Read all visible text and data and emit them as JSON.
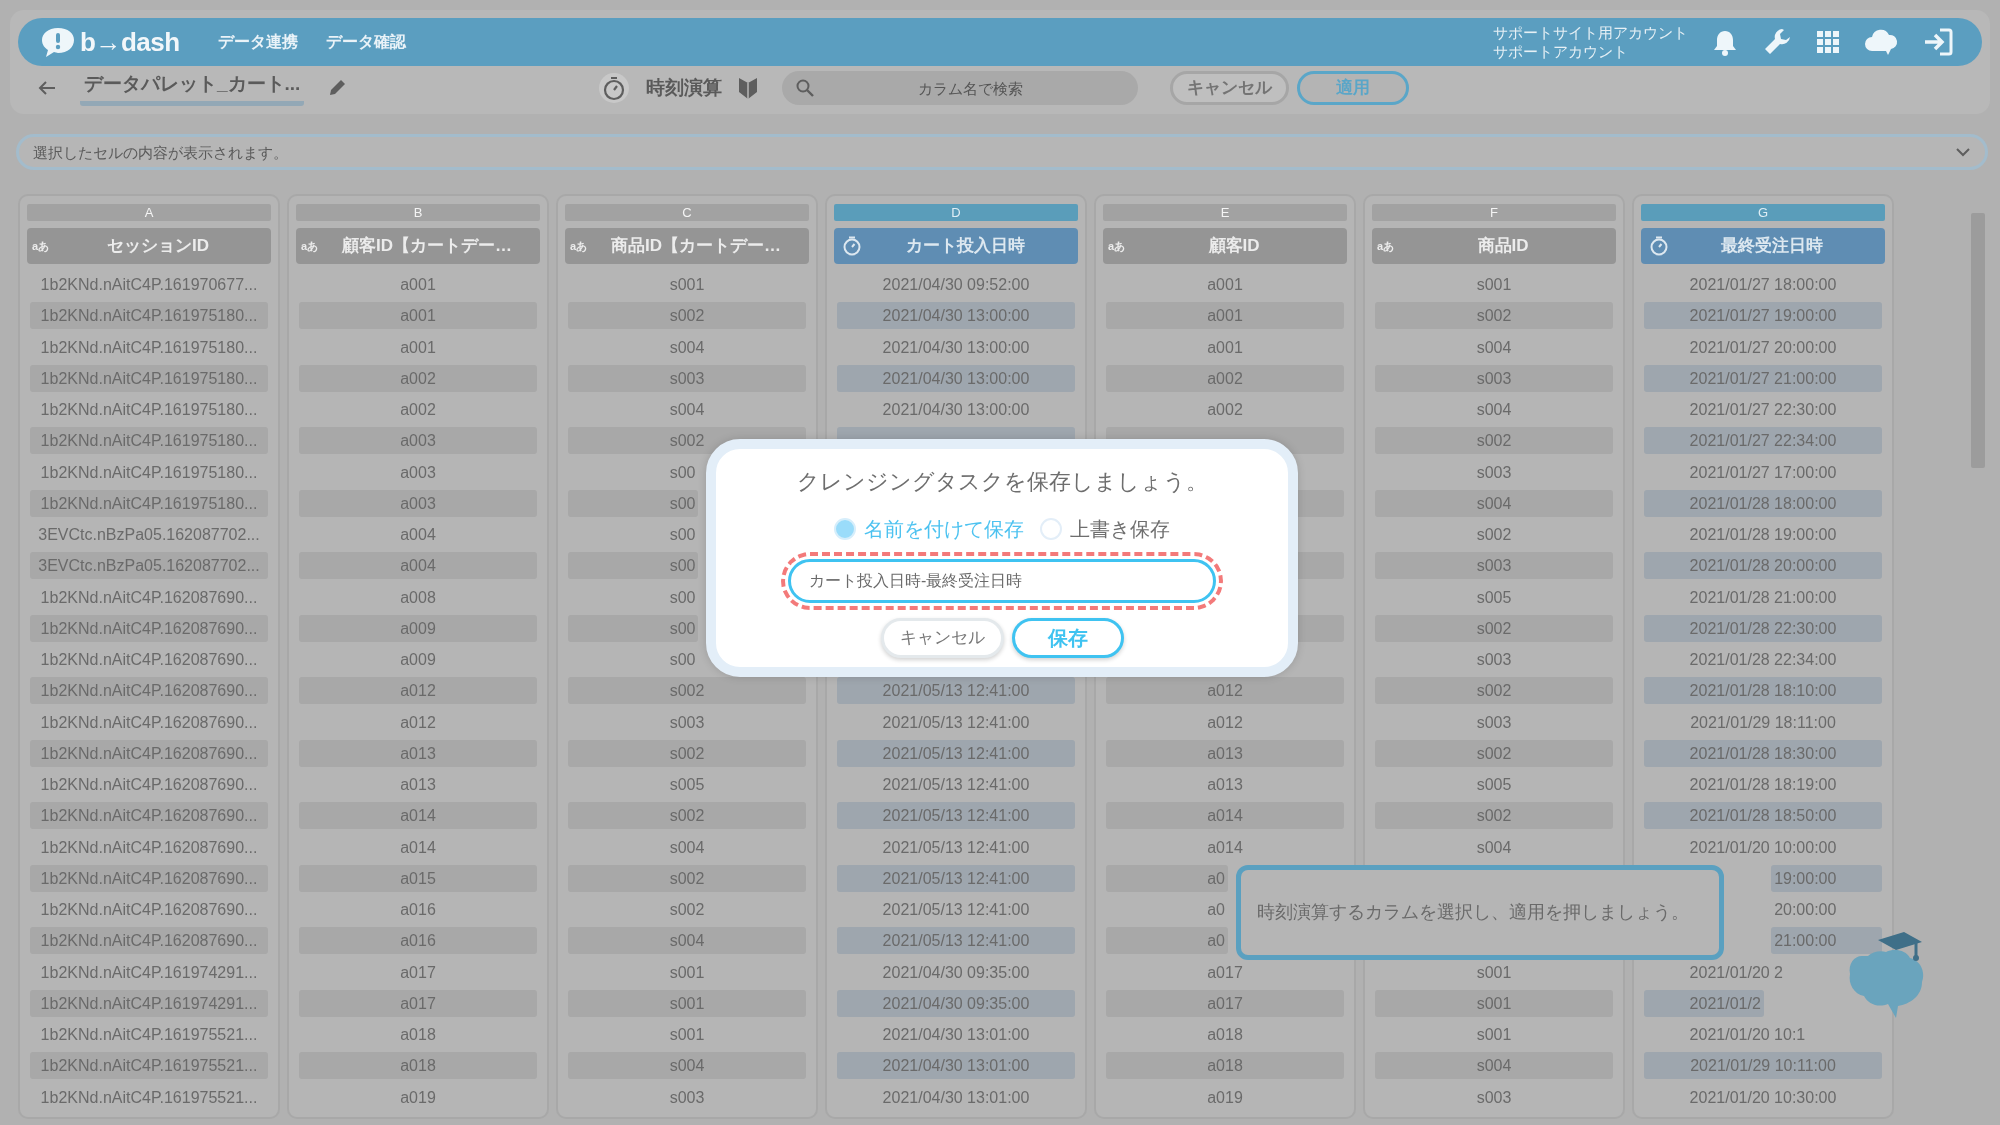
{
  "header": {
    "logo": "b→dash",
    "nav": [
      {
        "label": "データ連携"
      },
      {
        "label": "データ確認"
      }
    ],
    "account": {
      "site_account": "サポートサイト用アカウント",
      "account": "サポートアカウント"
    }
  },
  "toolbar": {
    "title": "データパレット_カート...",
    "mode": "時刻演算",
    "search": {
      "placeholder": "カラム名で検索"
    },
    "buttons": [
      {
        "label": "キャンセル",
        "kind": "secondary"
      },
      {
        "label": "適用",
        "kind": "primary"
      }
    ]
  },
  "cell_viewer": {
    "placeholder": "選択したセルの内容が表示されます。"
  },
  "table": {
    "columns": [
      {
        "letter": "A",
        "name": "セッションID",
        "kind": "text",
        "type_label": "aあ",
        "selected": false
      },
      {
        "letter": "B",
        "name": "顧客ID【カートデー…",
        "kind": "text",
        "type_label": "aあ",
        "selected": false
      },
      {
        "letter": "C",
        "name": "商品ID【カートデー…",
        "kind": "text",
        "type_label": "aあ",
        "selected": false
      },
      {
        "letter": "D",
        "name": "カート投入日時",
        "kind": "datetime",
        "selected": true
      },
      {
        "letter": "E",
        "name": "顧客ID",
        "kind": "text",
        "type_label": "aあ",
        "selected": false
      },
      {
        "letter": "F",
        "name": "商品ID",
        "kind": "text",
        "type_label": "aあ",
        "selected": false
      },
      {
        "letter": "G",
        "name": "最終受注日時",
        "kind": "datetime",
        "selected": true
      }
    ],
    "rows": [
      [
        "1b2KNd.nAitC4P.161970677...",
        "a001",
        "s001",
        "2021/04/30 09:52:00",
        "a001",
        "s001",
        "2021/01/27 18:00:00"
      ],
      [
        "1b2KNd.nAitC4P.161975180...",
        "a001",
        "s002",
        "2021/04/30 13:00:00",
        "a001",
        "s002",
        "2021/01/27 19:00:00"
      ],
      [
        "1b2KNd.nAitC4P.161975180...",
        "a001",
        "s004",
        "2021/04/30 13:00:00",
        "a001",
        "s004",
        "2021/01/27 20:00:00"
      ],
      [
        "1b2KNd.nAitC4P.161975180...",
        "a002",
        "s003",
        "2021/04/30 13:00:00",
        "a002",
        "s003",
        "2021/01/27 21:00:00"
      ],
      [
        "1b2KNd.nAitC4P.161975180...",
        "a002",
        "s004",
        "2021/04/30 13:00:00",
        "a002",
        "s004",
        "2021/01/27 22:30:00"
      ],
      [
        "1b2KNd.nAitC4P.161975180...",
        "a003",
        "s002",
        null,
        null,
        "s002",
        "2021/01/27 22:34:00"
      ],
      [
        "1b2KNd.nAitC4P.161975180...",
        "a003",
        {
          "text": "s00",
          "cut_end": true
        },
        null,
        null,
        "s003",
        "2021/01/27 17:00:00"
      ],
      [
        "1b2KNd.nAitC4P.161975180...",
        "a003",
        {
          "text": "s00",
          "cut_end": true
        },
        null,
        null,
        "s004",
        "2021/01/28 18:00:00"
      ],
      [
        "3EVCtc.nBzPa05.162087702...",
        "a004",
        {
          "text": "s00",
          "cut_end": true
        },
        null,
        null,
        "s002",
        "2021/01/28 19:00:00"
      ],
      [
        "3EVCtc.nBzPa05.162087702...",
        "a004",
        {
          "text": "s00",
          "cut_end": true
        },
        null,
        null,
        "s003",
        "2021/01/28 20:00:00"
      ],
      [
        "1b2KNd.nAitC4P.162087690...",
        "a008",
        {
          "text": "s00",
          "cut_end": true
        },
        null,
        null,
        "s005",
        "2021/01/28 21:00:00"
      ],
      [
        "1b2KNd.nAitC4P.162087690...",
        "a009",
        {
          "text": "s00",
          "cut_end": true
        },
        null,
        null,
        "s002",
        "2021/01/28 22:30:00"
      ],
      [
        "1b2KNd.nAitC4P.162087690...",
        "a009",
        {
          "text": "s00",
          "cut_end": true
        },
        null,
        null,
        "s003",
        "2021/01/28 22:34:00"
      ],
      [
        "1b2KNd.nAitC4P.162087690...",
        "a012",
        "s002",
        "2021/05/13 12:41:00",
        "a012",
        "s002",
        "2021/01/28 18:10:00"
      ],
      [
        "1b2KNd.nAitC4P.162087690...",
        "a012",
        "s003",
        "2021/05/13 12:41:00",
        "a012",
        "s003",
        "2021/01/29 18:11:00"
      ],
      [
        "1b2KNd.nAitC4P.162087690...",
        "a013",
        "s002",
        "2021/05/13 12:41:00",
        "a013",
        "s002",
        "2021/01/28 18:30:00"
      ],
      [
        "1b2KNd.nAitC4P.162087690...",
        "a013",
        "s005",
        "2021/05/13 12:41:00",
        "a013",
        "s005",
        "2021/01/28 18:19:00"
      ],
      [
        "1b2KNd.nAitC4P.162087690...",
        "a014",
        "s002",
        "2021/05/13 12:41:00",
        "a014",
        "s002",
        "2021/01/28 18:50:00"
      ],
      [
        "1b2KNd.nAitC4P.162087690...",
        "a014",
        "s004",
        "2021/05/13 12:41:00",
        "a014",
        "s004",
        "2021/01/20 10:00:00"
      ],
      [
        "1b2KNd.nAitC4P.162087690...",
        "a015",
        "s002",
        "2021/05/13 12:41:00",
        {
          "text": "a0",
          "cut_end": true
        },
        null,
        {
          "text": "19:00:00",
          "cut_start": true
        }
      ],
      [
        "1b2KNd.nAitC4P.162087690...",
        "a016",
        "s002",
        "2021/05/13 12:41:00",
        {
          "text": "a0",
          "cut_end": true
        },
        null,
        {
          "text": "20:00:00",
          "cut_start": true
        }
      ],
      [
        "1b2KNd.nAitC4P.162087690...",
        "a016",
        "s004",
        "2021/05/13 12:41:00",
        {
          "text": "a0",
          "cut_end": true
        },
        null,
        {
          "text": "21:00:00",
          "cut_start": true
        }
      ],
      [
        "1b2KNd.nAitC4P.161974291...",
        "a017",
        "s001",
        "2021/04/30 09:35:00",
        "a017",
        "s001",
        {
          "text": "2021/01/20 2",
          "cut_end": true
        }
      ],
      [
        "1b2KNd.nAitC4P.161974291...",
        "a017",
        "s001",
        "2021/04/30 09:35:00",
        "a017",
        "s001",
        {
          "text": "2021/01/2",
          "cut_end": true
        }
      ],
      [
        "1b2KNd.nAitC4P.161975521...",
        "a018",
        "s001",
        "2021/04/30 13:01:00",
        "a018",
        "s001",
        {
          "text": "2021/01/20 10:1",
          "cut_end": true
        }
      ],
      [
        "1b2KNd.nAitC4P.161975521...",
        "a018",
        "s004",
        "2021/04/30 13:01:00",
        "a018",
        "s004",
        "2021/01/29 10:11:00"
      ],
      [
        "1b2KNd.nAitC4P.161975521...",
        "a019",
        "s003",
        "2021/04/30 13:01:00",
        "a019",
        "s003",
        "2021/01/20 10:30:00"
      ]
    ]
  },
  "dialog": {
    "title": "クレンジングタスクを保存しましょう。",
    "options": [
      {
        "label": "名前を付けて保存",
        "selected": true
      },
      {
        "label": "上書き保存",
        "selected": false
      }
    ],
    "input": {
      "value": "カート投入日時-最終受注日時",
      "highlighted": true
    },
    "buttons": [
      {
        "label": "キャンセル",
        "kind": "secondary"
      },
      {
        "label": "保存",
        "kind": "primary"
      }
    ]
  },
  "tip": {
    "text": "時刻演算するカラムを選択し、適用を押しましょう。"
  }
}
